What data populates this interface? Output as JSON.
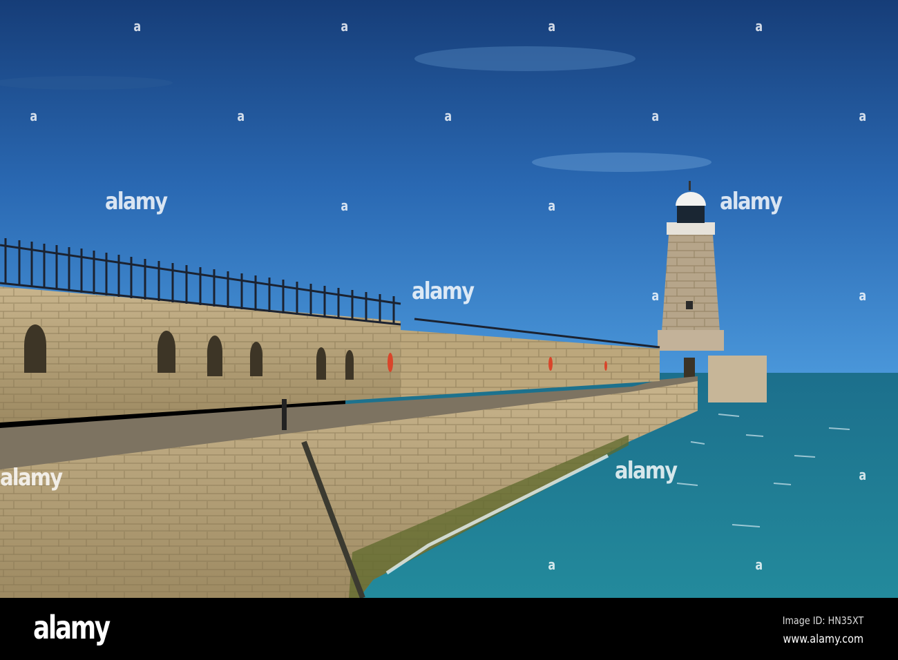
{
  "photo": {
    "watermark": "alamy",
    "watermark_mark": "a",
    "colors": {
      "sky_top": "#17407a",
      "sky_bottom": "#3f8fd6",
      "sea": "#1f7f93",
      "stone": "#c9b48a"
    }
  },
  "footer": {
    "brand": "alamy",
    "image_id": "Image ID: HN35XT",
    "url": "www.alamy.com"
  }
}
